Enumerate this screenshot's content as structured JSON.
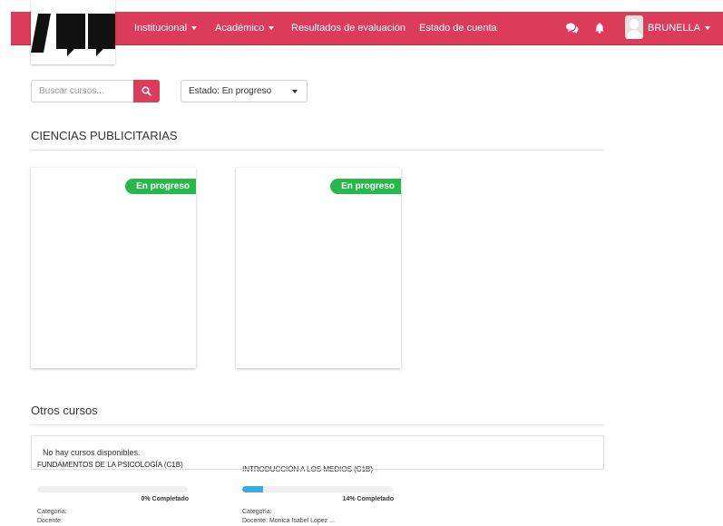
{
  "nav": {
    "items": [
      {
        "label": "Institucional",
        "dropdown": true
      },
      {
        "label": "Académico",
        "dropdown": true
      },
      {
        "label": "Resultados de evaluación",
        "dropdown": false
      },
      {
        "label": "Estado de cuenta",
        "dropdown": false
      }
    ],
    "user_name": "BRUNELLA",
    "icons": [
      "chat-icon",
      "bell-icon",
      "user-avatar-icon"
    ],
    "accent_color": "#dc3c5a"
  },
  "search": {
    "placeholder": "Buscar cursos...",
    "button_icon": "search-icon"
  },
  "filter": {
    "selected": "Estado: En progreso"
  },
  "program": {
    "title": "CIENCIAS PUBLICITARIAS",
    "courses": [
      {
        "title": "FUNDAMENTOS DE LA PSICOLOGÍA (C1B)",
        "badge": "En progreso",
        "progress": 0,
        "progress_label": "0% Completado",
        "category": "Categoría:",
        "teacher": "Docente:"
      },
      {
        "title": "INTRODUCCIÓN A LOS MEDIOS (C1B)",
        "badge": "En progreso",
        "progress": 14,
        "progress_label": "14% Completado",
        "category": "Categoría:",
        "teacher": "Docente: Monica Isabel Lopez ..."
      }
    ]
  },
  "other": {
    "title": "Otros cursos",
    "empty_message": "No hay cursos disponibles."
  },
  "colors": {
    "badge_green": "#27b84a",
    "progress_blue": "#3aa8e6"
  }
}
